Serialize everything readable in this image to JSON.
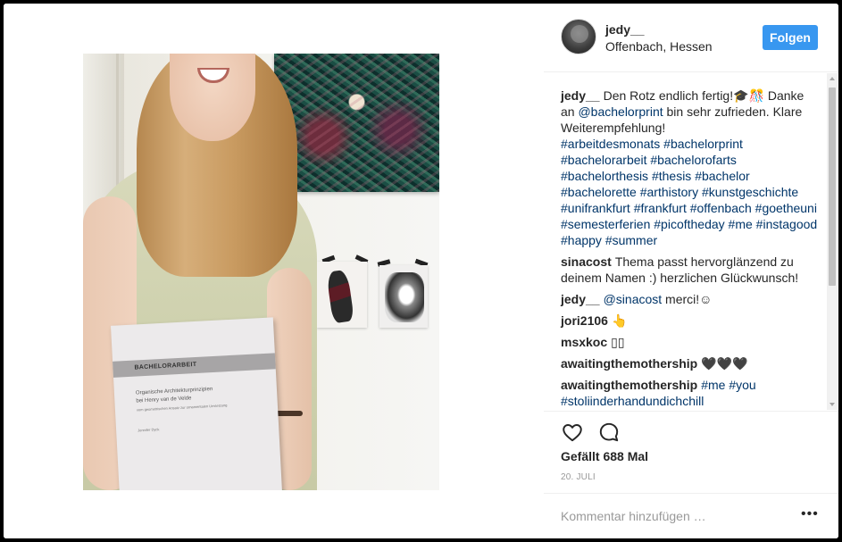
{
  "post": {
    "username": "jedy__",
    "location": "Offenbach, Hessen",
    "follow_label": "Folgen",
    "likes": "Gefällt 688 Mal",
    "date": "20. JULI",
    "add_comment_placeholder": "Kommentar hinzufügen …",
    "more_options": "•••"
  },
  "book": {
    "title": "BACHELORARBEIT",
    "line1": "Organische Architekturprinzipien",
    "line2": "bei Henry van de Velde",
    "line3": "vom geometrischen Ansatz zur ornamentalen Umsetzung",
    "author": "Jennifer Dyck"
  },
  "comments": [
    {
      "author": "jedy__",
      "text": "Den Rotz endlich fertig!🎓🎊 Danke an ",
      "mention": "@bachelorprint",
      "text2": " bin sehr zufrieden. Klare Weiterempfehlung!",
      "hashtags": "#arbeitdesmonats #bachelorprint #bachelorarbeit #bachelorofarts #bachelorthesis #thesis #bachelor #bachelorette #arthistory #kunstgeschichte #unifrankfurt #frankfurt #offenbach #goetheuni #semesterferien #picoftheday #me #instagood #happy #summer"
    },
    {
      "author": "sinacost",
      "text": "Thema passt hervorglänzend zu deinem Namen :) herzlichen Glückwunsch!"
    },
    {
      "author": "jedy__",
      "mention": "@sinacost",
      "text": " merci!☺"
    },
    {
      "author": "jori2106",
      "text": "👆"
    },
    {
      "author": "msxkoc",
      "text": "▯▯"
    },
    {
      "author": "awaitingthemothership",
      "text": "🖤🖤🖤"
    },
    {
      "author": "awaitingthemothership",
      "hashtags": "#me #you #stoliinderhandundichchill"
    }
  ],
  "icons": [
    "heart-icon",
    "comment-icon",
    "more-options-icon"
  ]
}
